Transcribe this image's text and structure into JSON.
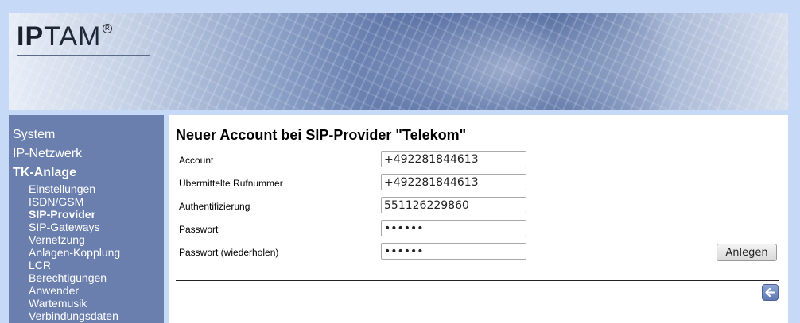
{
  "logo": {
    "text_bold": "IP",
    "text_rest": "TAM",
    "reg": "R"
  },
  "nav": {
    "system": "System",
    "ip_netzwerk": "IP-Netzwerk",
    "tk_anlage": "TK-Anlage",
    "items": [
      {
        "label": "Einstellungen"
      },
      {
        "label": "ISDN/GSM"
      },
      {
        "label": "SIP-Provider"
      },
      {
        "label": "SIP-Gateways"
      },
      {
        "label": "Vernetzung"
      },
      {
        "label": "Anlagen-Kopplung"
      },
      {
        "label": "LCR"
      },
      {
        "label": "Berechtigungen"
      },
      {
        "label": "Anwender"
      },
      {
        "label": "Wartemusik"
      },
      {
        "label": "Verbindungsdaten"
      }
    ]
  },
  "form": {
    "title": "Neuer Account bei SIP-Provider \"Telekom\"",
    "account_label": "Account",
    "account_value": "+492281844613",
    "rufnummer_label": "Übermittelte Rufnummer",
    "rufnummer_value": "+492281844613",
    "auth_label": "Authentifizierung",
    "auth_value": "551126229860",
    "passwort_label": "Passwort",
    "passwort_value": "xxxxxx",
    "passwort2_label": "Passwort (wiederholen)",
    "passwort2_value": "xxxxxx",
    "submit_label": "Anlegen"
  },
  "colors": {
    "page_bg": "#c6d9f7",
    "sidebar_bg": "#6a7fae",
    "back_button": "#6f87c0"
  },
  "icons": {
    "back": "arrow-left-icon"
  }
}
